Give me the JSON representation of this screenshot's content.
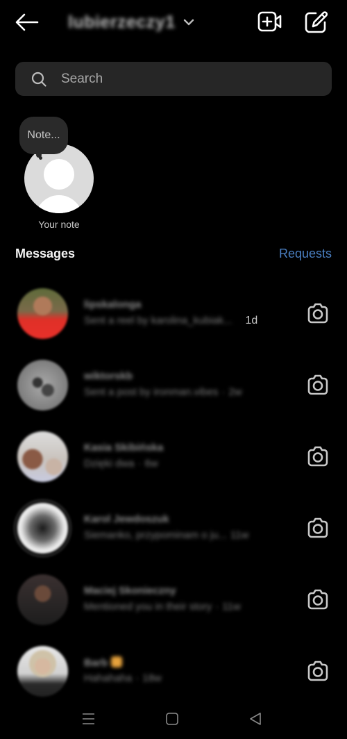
{
  "header": {
    "account_name": "lubierzeczy1",
    "icons": {
      "back": "arrow-left-icon",
      "dropdown": "chevron-down-icon",
      "video": "video-call-plus-icon",
      "compose": "compose-pencil-icon"
    }
  },
  "search": {
    "placeholder": "Search",
    "value": "",
    "icon": "search-icon"
  },
  "note": {
    "bubble_text": "Note...",
    "label": "Your note"
  },
  "section": {
    "title": "Messages",
    "requests_label": "Requests"
  },
  "colors": {
    "background": "#000000",
    "accent_link": "#4a7fc1",
    "search_bg": "#262626"
  },
  "threads": [
    {
      "name": "lipskalonga",
      "preview": "Sent a reel by karolina_kubiak...",
      "time": "1d",
      "sep": "",
      "time_sharp": true,
      "emoji": false
    },
    {
      "name": "wiktorskb",
      "preview": "Sent a post by ironman.vibes",
      "time": "2w",
      "sep": "·",
      "time_sharp": false,
      "emoji": false
    },
    {
      "name": "Kasia Skibińska",
      "preview": "Dzięki dwa",
      "time": "6w",
      "sep": "·",
      "time_sharp": false,
      "emoji": false
    },
    {
      "name": "Karol Jewdoszuk",
      "preview": "Siemanko, przypominam o ju...",
      "time": "11w",
      "sep": "",
      "time_sharp": false,
      "emoji": false
    },
    {
      "name": "Maciej Skonieczny",
      "preview": "Mentioned you in their story",
      "time": "11w",
      "sep": "·",
      "time_sharp": false,
      "emoji": false
    },
    {
      "name": "Barb",
      "preview": "Hahahaha",
      "time": "18w",
      "sep": "·",
      "time_sharp": false,
      "emoji": true
    }
  ],
  "navbar": {
    "icons": [
      "recent-apps-icon",
      "home-icon",
      "back-triangle-icon"
    ]
  }
}
